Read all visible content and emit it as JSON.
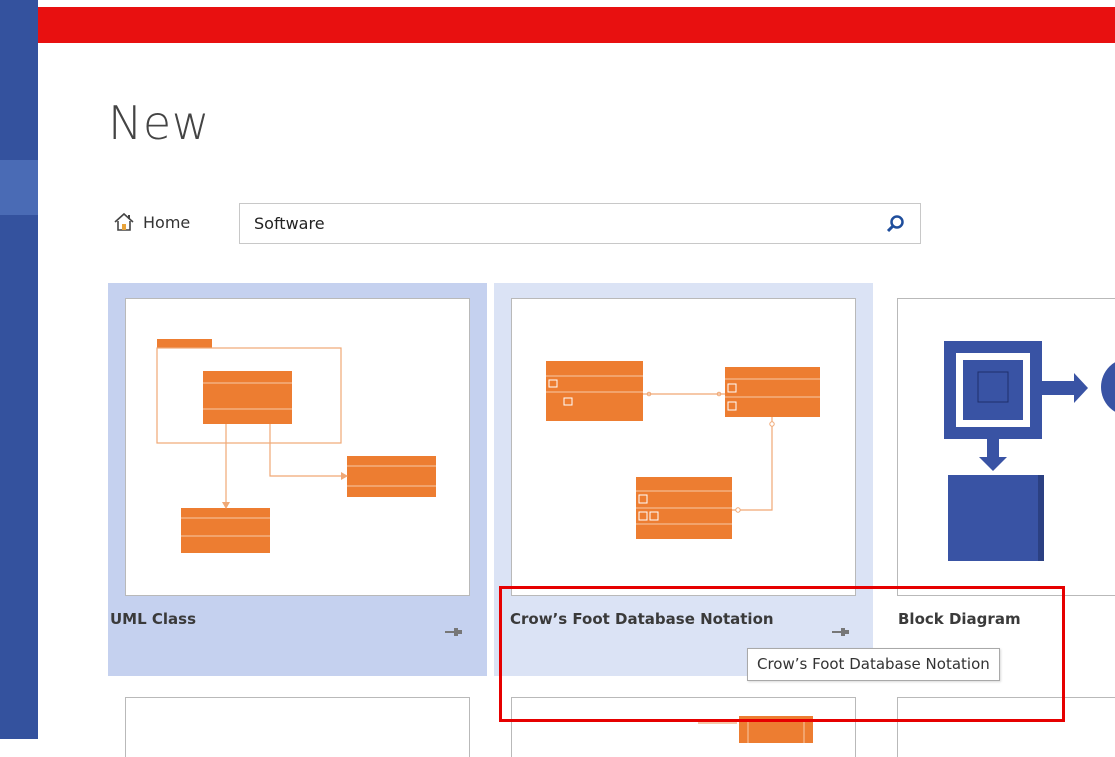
{
  "page": {
    "title": "New"
  },
  "nav": {
    "home_label": "Home"
  },
  "search": {
    "value": "Software",
    "icon": "search-icon"
  },
  "templates": [
    {
      "label": "UML Class",
      "state": "selected"
    },
    {
      "label": "Crow’s Foot Database Notation",
      "state": "hover"
    },
    {
      "label": "Block Diagram",
      "state": "normal"
    }
  ],
  "tooltip": {
    "text": "Crow’s Foot Database Notation"
  },
  "colors": {
    "accent_bar": "#e81010",
    "sidebar": "#34529e",
    "selected_tile": "#c5d1ef",
    "hover_tile": "#dbe3f5",
    "diagram_orange": "#ed7d31",
    "block_blue": "#3953a4"
  }
}
